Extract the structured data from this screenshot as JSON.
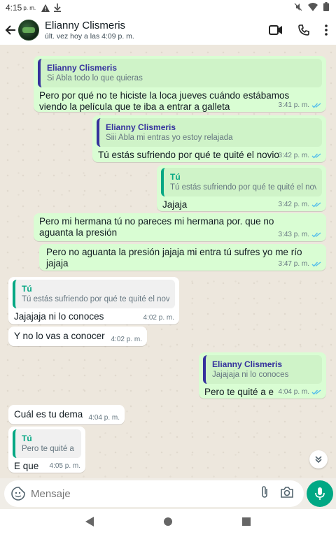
{
  "status": {
    "time": "4:15",
    "ampm": "p. m."
  },
  "header": {
    "name": "Elianny Clismeris",
    "last_seen": "últ. vez hoy a las 4:09 p. m."
  },
  "messages": [
    {
      "quote_name": "Elianny Clismeris",
      "quote_text": "Si Abla todo lo que quieras",
      "text": "Pero por qué no te hiciste la loca jueves cuándo estábamos viendo la película que  te iba   a  entrar a galleta",
      "time": "3:41 p. m."
    },
    {
      "quote_name": "Elianny Clismeris",
      "quote_text": "Siii Abla mi entras yo estoy relajada",
      "text": "Tú estás sufriendo por qué te quité el novio",
      "time": "3:42 p. m."
    },
    {
      "quote_name": "Tú",
      "quote_text": "Tú estás sufriendo por qué te quité el novio",
      "text": "Jajaja",
      "time": "3:42 p. m."
    },
    {
      "text": "Pero mi hermana tú no  pareces mi hermana por.  que no aguanta la presión",
      "time": "3:43 p. m."
    },
    {
      "text": "Pero no aguanta la presión jajaja  mi entra  tú sufres yo me  río jajaja",
      "time": "3:47 p. m."
    },
    {
      "quote_name": "Tú",
      "quote_text": "Tú estás sufriendo por qué te quité el novio",
      "text": "Jajajaja ni lo conoces",
      "time": "4:02 p. m."
    },
    {
      "text": "Y no lo vas a conocer",
      "time": "4:02 p. m."
    },
    {
      "quote_name": "Elianny Clismeris",
      "quote_text": "Jajajaja ni lo conoces",
      "text": "Pero te quité a  e",
      "time": "4:04 p. m."
    },
    {
      "text": "Cuál es tu dema",
      "time": "4:04 p. m."
    },
    {
      "quote_name": "Tú",
      "quote_text": "Pero te quité a  e",
      "text": "E que",
      "time": "4:05 p. m."
    }
  ],
  "input": {
    "placeholder": "Mensaje"
  },
  "colors": {
    "header_bg": "#ffffff",
    "outgoing_bubble": "#d9fdd3",
    "incoming_bubble": "#ffffff",
    "accent": "#00a884",
    "read_ticks": "#53bdeb"
  }
}
